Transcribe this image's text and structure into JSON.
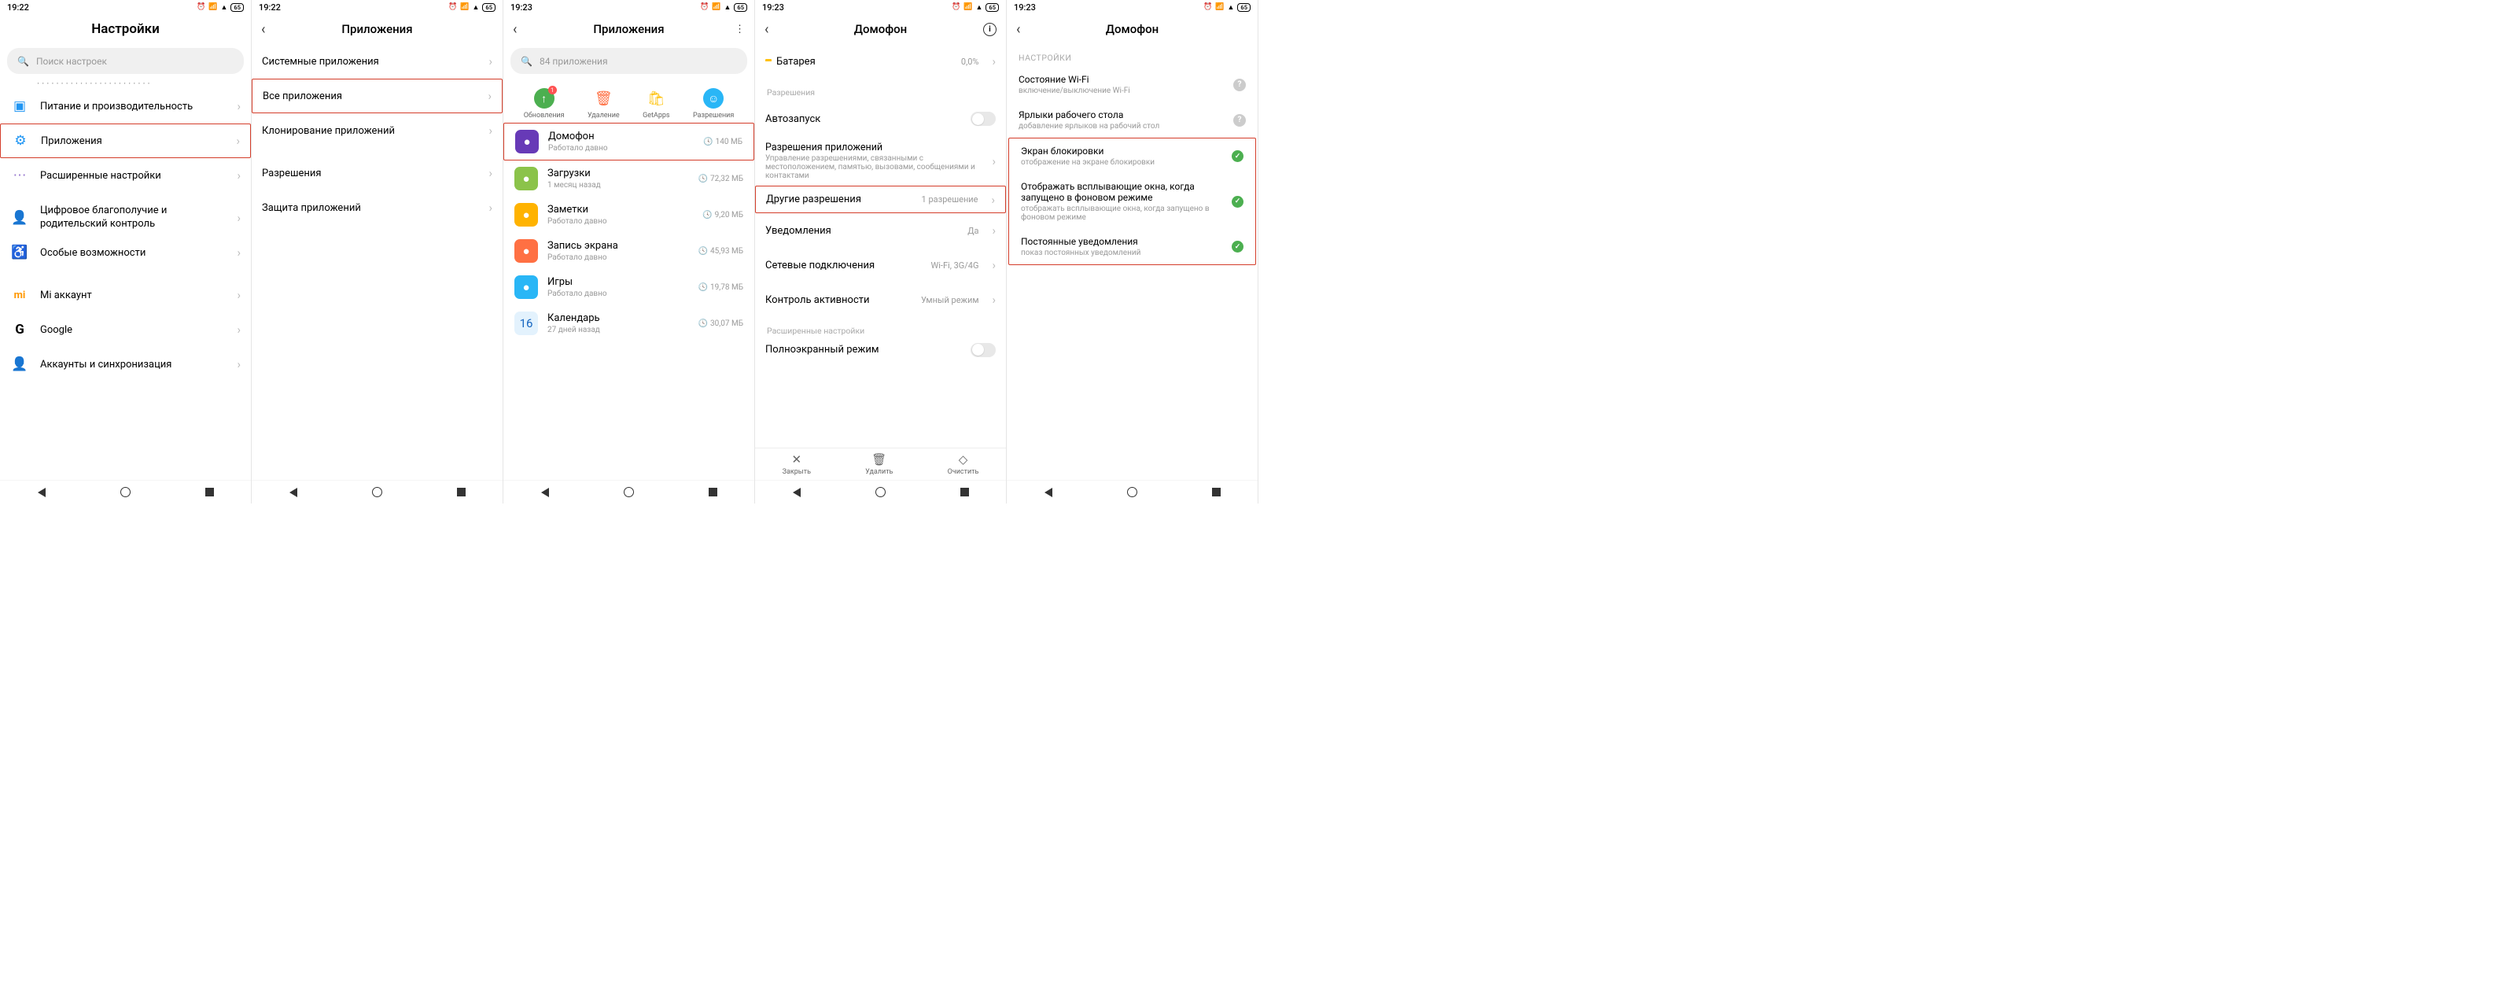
{
  "screens": [
    {
      "time": "19:22",
      "title": "Настройки",
      "search_placeholder": "Поиск настроек",
      "items": [
        {
          "label": "Питание и производительность",
          "icon_color": "#2196f3"
        },
        {
          "label": "Приложения",
          "icon_color": "#2196f3",
          "highlighted": true
        },
        {
          "label": "Расширенные настройки",
          "icon_color": "#9575cd"
        },
        {
          "label": "Цифровое благополучие и родительский контроль",
          "icon_color": "#4caf50"
        },
        {
          "label": "Особые возможности",
          "icon_color": "#7e57c2"
        },
        {
          "label": "Mi аккаунт",
          "icon_color": "#ff9800"
        },
        {
          "label": "Google",
          "icon_color": ""
        },
        {
          "label": "Аккаунты и синхронизация",
          "icon_color": "#2196f3"
        }
      ]
    },
    {
      "time": "19:22",
      "title": "Приложения",
      "items": [
        {
          "label": "Системные приложения"
        },
        {
          "label": "Все приложения",
          "highlighted": true
        },
        {
          "label": "Клонирование приложений"
        },
        {
          "label": "Разрешения"
        },
        {
          "label": "Защита приложений"
        }
      ]
    },
    {
      "time": "19:23",
      "title": "Приложения",
      "search_placeholder": "84 приложения",
      "toolbar": [
        {
          "label": "Обновления",
          "color": "#4caf50",
          "badge": "1"
        },
        {
          "label": "Удаление",
          "color": "#ff7043"
        },
        {
          "label": "GetApps",
          "color": "#ffc107"
        },
        {
          "label": "Разрешения",
          "color": "#29b6f6"
        }
      ],
      "apps": [
        {
          "name": "Домофон",
          "sub": "Работало давно",
          "size": "140 МБ",
          "color": "#673ab7",
          "highlighted": true
        },
        {
          "name": "Загрузки",
          "sub": "1 месяц назад",
          "size": "72,32 МБ",
          "color": "#8bc34a"
        },
        {
          "name": "Заметки",
          "sub": "Работало давно",
          "size": "9,20 МБ",
          "color": "#ffb300"
        },
        {
          "name": "Запись экрана",
          "sub": "Работало давно",
          "size": "45,93 МБ",
          "color": "#ff7043"
        },
        {
          "name": "Игры",
          "sub": "Работало давно",
          "size": "19,78 МБ",
          "color": "#29b6f6"
        },
        {
          "name": "Календарь",
          "sub": "27 дней назад",
          "size": "30,07 МБ",
          "color": "#e3f2fd",
          "text": "16"
        }
      ]
    },
    {
      "time": "19:23",
      "title": "Домофон",
      "top_row": {
        "label": "Батарея",
        "value": "0,0%"
      },
      "section1": "Разрешения",
      "rows": [
        {
          "label": "Автозапуск",
          "toggle": true
        },
        {
          "label": "Разрешения приложений",
          "sub": "Управление разрешениями, связанными с местоположением, памятью, вызовами, сообщениями и контактами"
        },
        {
          "label": "Другие разрешения",
          "value": "1 разрешение",
          "highlighted": true
        },
        {
          "label": "Уведомления",
          "value": "Да"
        },
        {
          "label": "Сетевые подключения",
          "value": "Wi-Fi, 3G/4G"
        },
        {
          "label": "Контроль активности",
          "value": "Умный режим"
        }
      ],
      "section2": "Расширенные настройки",
      "row2_label": "Полноэкранный режим",
      "actions": [
        {
          "label": "Закрыть",
          "icon": "✕"
        },
        {
          "label": "Удалить",
          "icon": "🗑"
        },
        {
          "label": "Очистить",
          "icon": "◇"
        }
      ]
    },
    {
      "time": "19:23",
      "title": "Домофон",
      "section": "НАСТРОЙКИ",
      "perms": [
        {
          "title": "Состояние Wi-Fi",
          "sub": "включение/выключение Wi-Fi",
          "state": "q"
        },
        {
          "title": "Ярлыки рабочего стола",
          "sub": "добавление ярлыков на рабочий стол",
          "state": "q"
        },
        {
          "title": "Экран блокировки",
          "sub": "отображение на экране блокировки",
          "state": "ok",
          "hl": true
        },
        {
          "title": "Отображать всплывающие окна, когда запущено в фоновом режиме",
          "sub": "отображать всплывающие окна, когда запущено в фоновом режиме",
          "state": "ok",
          "hl": true
        },
        {
          "title": "Постоянные уведомления",
          "sub": "показ постоянных уведомлений",
          "state": "ok",
          "hl": true
        }
      ]
    }
  ],
  "battery": "65"
}
